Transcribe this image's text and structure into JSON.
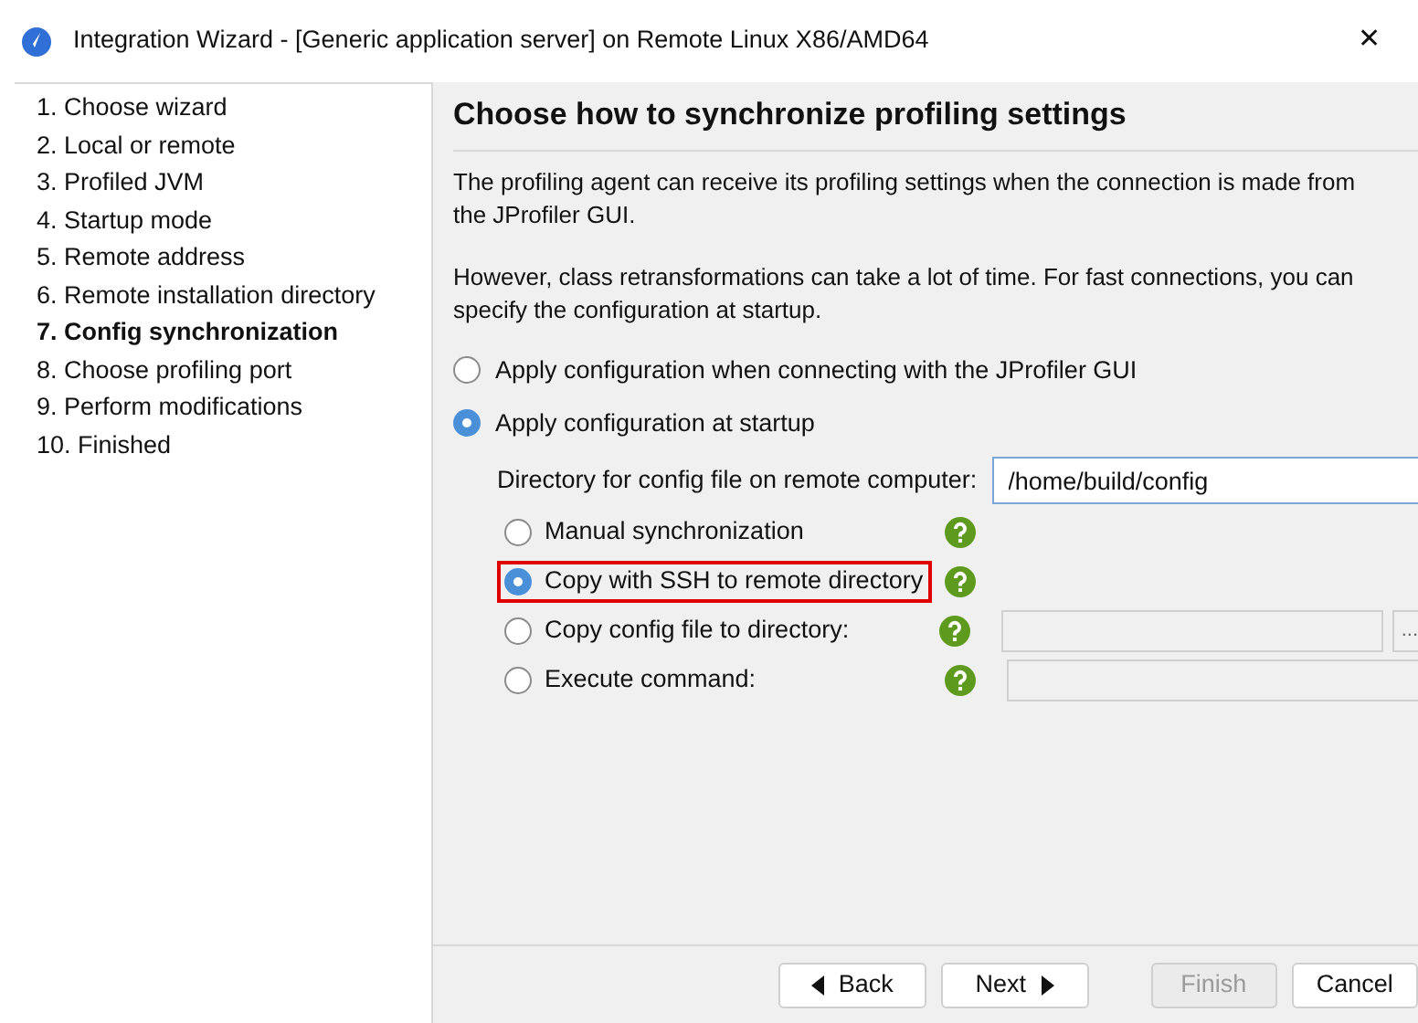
{
  "window": {
    "title": "Integration Wizard - [Generic application server] on Remote Linux X86/AMD64",
    "close": "✕"
  },
  "steps": [
    {
      "label": "1. Choose wizard",
      "selected": false
    },
    {
      "label": "2. Local or remote",
      "selected": false
    },
    {
      "label": "3. Profiled JVM",
      "selected": false
    },
    {
      "label": "4. Startup mode",
      "selected": false
    },
    {
      "label": "5. Remote address",
      "selected": false
    },
    {
      "label": "6. Remote installation directory",
      "selected": false
    },
    {
      "label": "7. Config synchronization",
      "selected": true
    },
    {
      "label": "8. Choose profiling port",
      "selected": false
    },
    {
      "label": "9. Perform modifications",
      "selected": false
    },
    {
      "label": "10. Finished",
      "selected": false
    }
  ],
  "page": {
    "heading": "Choose how to synchronize profiling settings",
    "paragraphs": [
      "The profiling agent can receive its profiling settings when the connection is made from the JProfiler GUI.",
      "However, class retransformations can take a lot of time. For fast connections, you can specify the configuration at startup."
    ],
    "apply_options": [
      {
        "label": "Apply configuration when connecting with the JProfiler GUI",
        "selected": false
      },
      {
        "label": "Apply configuration at startup",
        "selected": true
      }
    ],
    "directory": {
      "label": "Directory for config file on remote computer:",
      "value": "/home/build/config"
    },
    "sync_options": [
      {
        "kind": "plain",
        "label": "Manual synchronization",
        "selected": false,
        "highlighted": false
      },
      {
        "kind": "plain",
        "label": "Copy with SSH to remote directory",
        "selected": true,
        "highlighted": true
      },
      {
        "kind": "browse",
        "label": "Copy config file to directory:",
        "selected": false,
        "highlighted": false,
        "browse": "..."
      },
      {
        "kind": "field",
        "label": "Execute command:",
        "selected": false,
        "highlighted": false
      }
    ]
  },
  "buttons": [
    {
      "kind": "back",
      "label": "Back",
      "disabled": false
    },
    {
      "kind": "next",
      "label": "Next",
      "disabled": false
    },
    {
      "kind": "plain",
      "label": "Finish",
      "disabled": true
    },
    {
      "kind": "plain",
      "label": "Cancel",
      "disabled": false
    }
  ]
}
